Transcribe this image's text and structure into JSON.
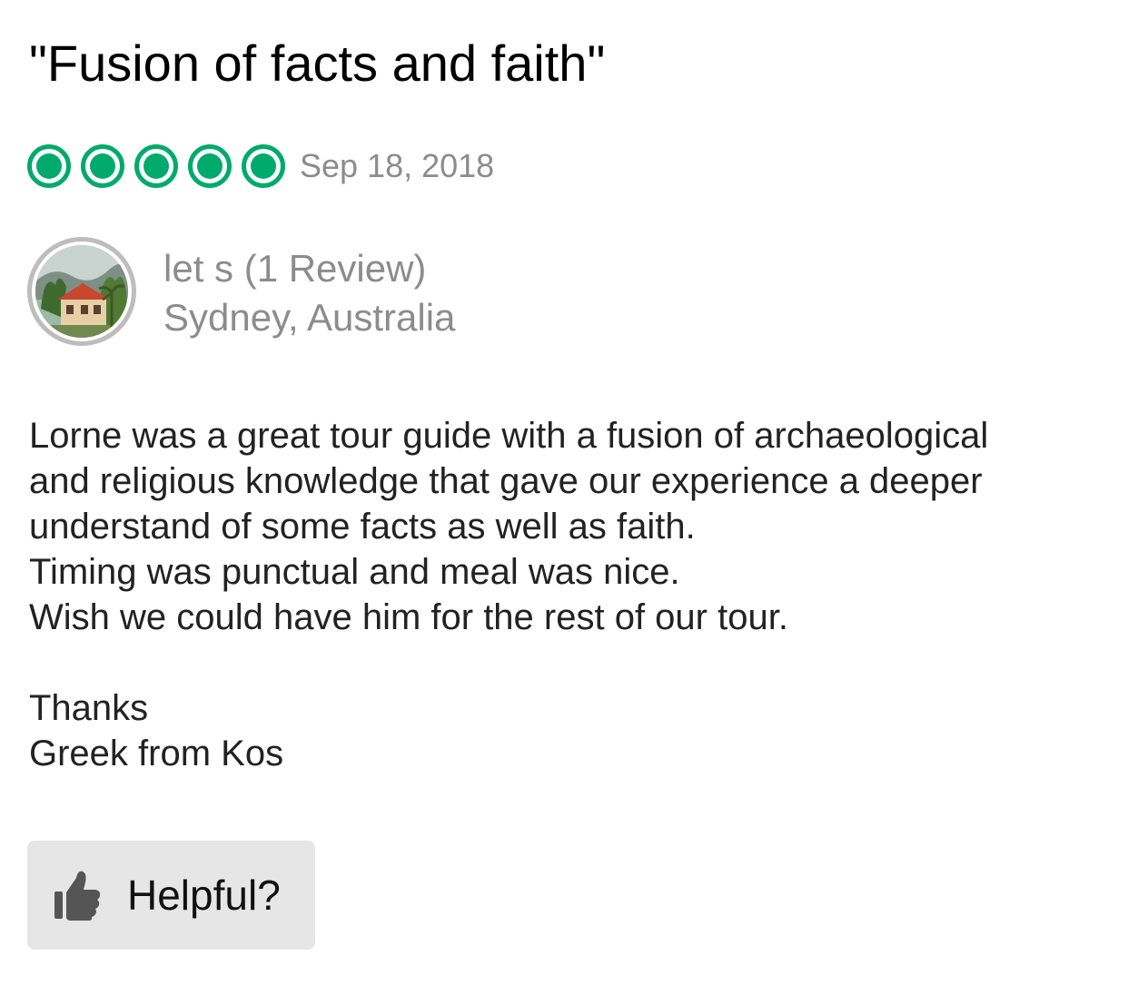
{
  "review": {
    "title": "\"Fusion of facts and faith\"",
    "rating": 5,
    "rating_max": 5,
    "rating_color": "#00aa6c",
    "date": "Sep 18, 2018",
    "reviewer": {
      "name": "let s",
      "review_count": "(1 Review)",
      "location": "Sydney, Australia"
    },
    "body_lines": [
      "Lorne was a great tour guide with a fusion of archaeological",
      "and religious knowledge that gave our experience a deeper",
      "understand of some facts as well as faith.",
      "Timing was punctual and meal was nice.",
      "Wish we could have him for the rest of our tour.",
      "",
      "Thanks",
      "Greek from Kos"
    ],
    "helpful_button": {
      "label": "Helpful?",
      "icon": "thumbs-up-icon"
    }
  }
}
